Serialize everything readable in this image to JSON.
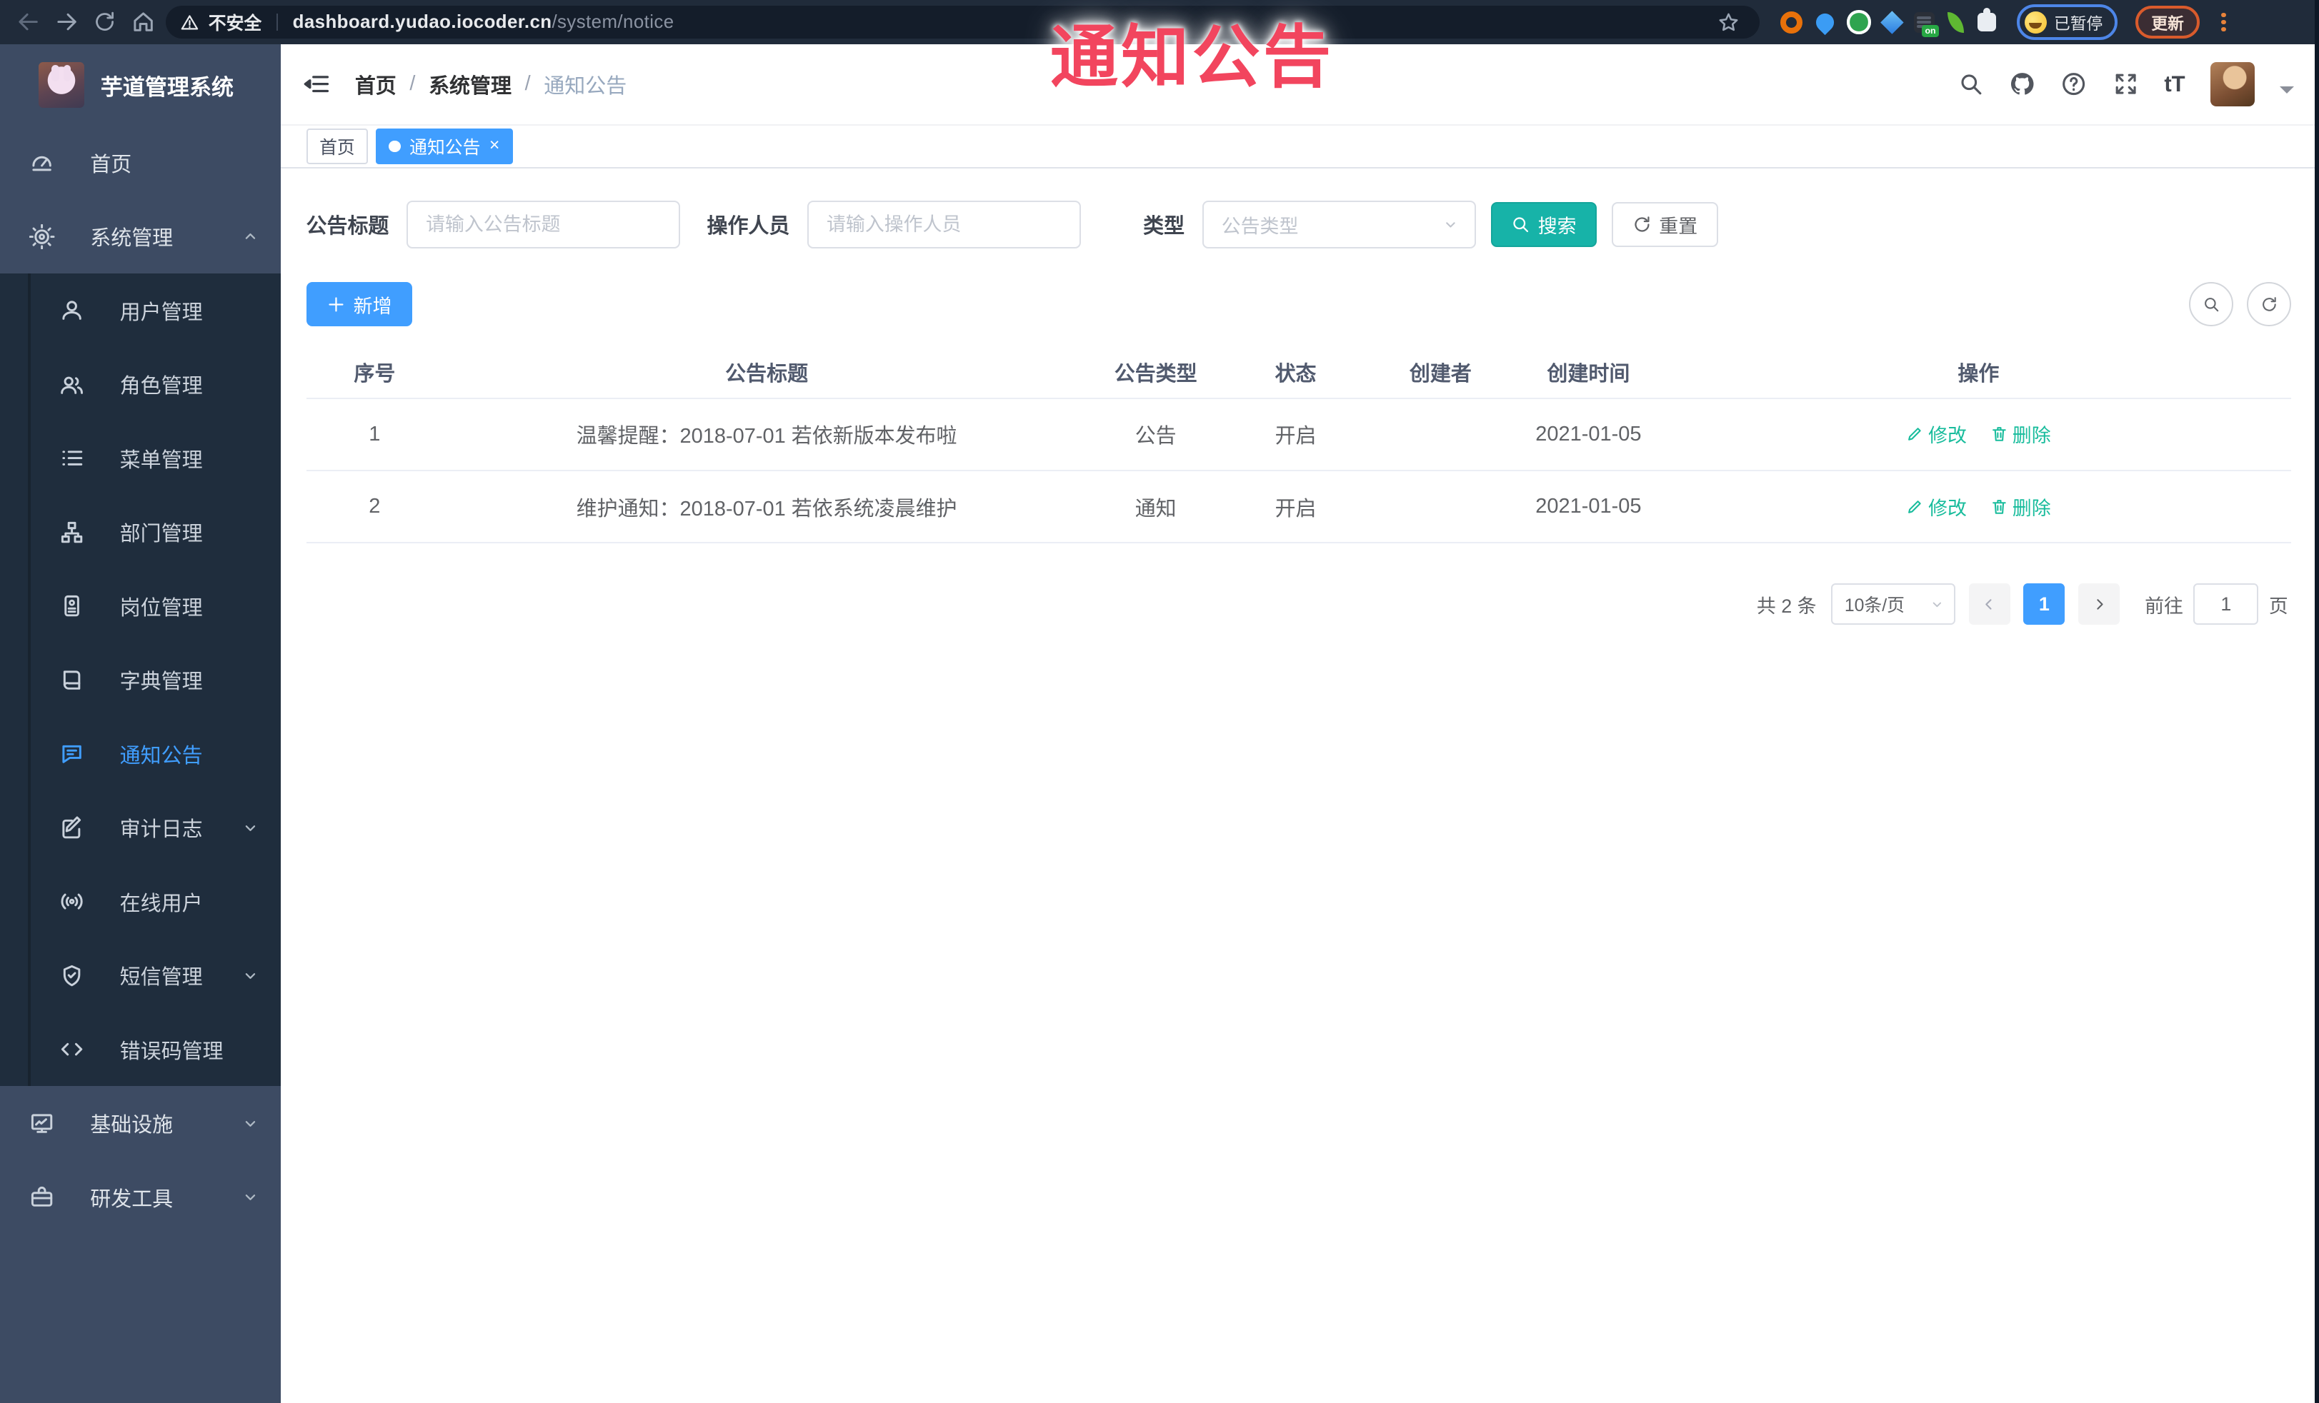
{
  "browser": {
    "security_label": "不安全",
    "url_host": "dashboard.yudao.iocoder.cn",
    "url_path": "/system/notice",
    "ext_badge": "on",
    "profile_label": "已暂停",
    "update_label": "更新"
  },
  "overlay": {
    "text": "通知公告",
    "color": "#f2455e"
  },
  "sidebar": {
    "title": "芋道管理系统",
    "home": {
      "label": "首页"
    },
    "system": {
      "label": "系统管理"
    },
    "system_children": [
      {
        "label": "用户管理"
      },
      {
        "label": "角色管理"
      },
      {
        "label": "菜单管理"
      },
      {
        "label": "部门管理"
      },
      {
        "label": "岗位管理"
      },
      {
        "label": "字典管理"
      },
      {
        "label": "通知公告",
        "active": true
      },
      {
        "label": "审计日志"
      },
      {
        "label": "在线用户"
      },
      {
        "label": "短信管理"
      },
      {
        "label": "错误码管理"
      }
    ],
    "infra": {
      "label": "基础设施"
    },
    "dev": {
      "label": "研发工具"
    }
  },
  "header": {
    "breadcrumbs": [
      "首页",
      "系统管理",
      "通知公告"
    ],
    "separator": "/",
    "font_size_label": "tT"
  },
  "tabs": {
    "items": [
      {
        "label": "首页",
        "active": false
      },
      {
        "label": "通知公告",
        "active": true
      }
    ],
    "close_glyph": "×"
  },
  "filters": {
    "title": {
      "label": "公告标题",
      "placeholder": "请输入公告标题"
    },
    "operator": {
      "label": "操作人员",
      "placeholder": "请输入操作人员"
    },
    "type": {
      "label": "类型",
      "placeholder": "公告类型"
    },
    "search_label": "搜索",
    "reset_label": "重置"
  },
  "toolbar": {
    "add_label": "新增"
  },
  "table": {
    "columns": [
      "序号",
      "公告标题",
      "公告类型",
      "状态",
      "创建者",
      "创建时间",
      "操作"
    ],
    "rows": [
      {
        "no": "1",
        "title": "温馨提醒：2018-07-01 若依新版本发布啦",
        "type": "公告",
        "status": "开启",
        "creator": "",
        "created": "2021-01-05"
      },
      {
        "no": "2",
        "title": "维护通知：2018-07-01 若依系统凌晨维护",
        "type": "通知",
        "status": "开启",
        "creator": "",
        "created": "2021-01-05"
      }
    ],
    "actions": {
      "edit": "修改",
      "delete": "删除"
    }
  },
  "pagination": {
    "total": "共 2 条",
    "page_size": "10条/页",
    "current": "1",
    "goto_label": "前往",
    "goto_value": "1",
    "unit": "页"
  },
  "colors": {
    "accent_blue": "#409eff",
    "search_teal": "#17b3a8",
    "action_link": "#18bc9c",
    "overlay_red": "#f2455e",
    "sidebar_bg": "#3d4b63",
    "submenu_bg": "#1f2d3d"
  }
}
